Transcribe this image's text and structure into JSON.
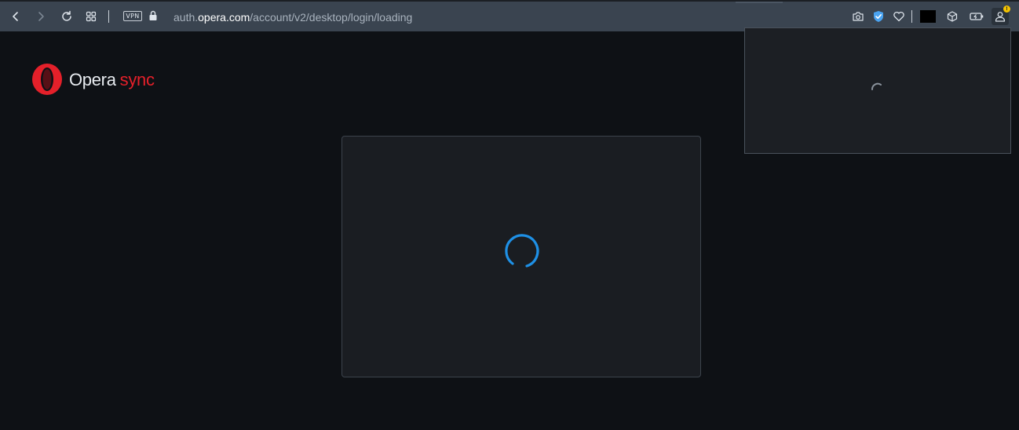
{
  "browser": {
    "address": {
      "prefix": "auth.",
      "host": "opera.com",
      "path": "/account/v2/desktop/login/loading"
    },
    "vpn_label": "VPN",
    "profile_badge": "!",
    "icons": {
      "back": "chevron-left-icon",
      "forward": "chevron-right-icon",
      "reload": "reload-icon",
      "speed_dial": "grid-icon",
      "lock": "lock-icon",
      "snapshot": "camera-icon",
      "adblock": "shield-check-icon",
      "favorite": "heart-icon",
      "easy_setup": "cube-icon",
      "battery": "battery-icon",
      "profile": "user-icon"
    }
  },
  "page": {
    "logo": {
      "brand": "Opera",
      "product": "sync"
    },
    "colors": {
      "brand_red": "#e4202a",
      "spinner_blue": "#1e90e6",
      "page_bg": "#0e1115",
      "card_bg": "#1a1d22"
    },
    "status": "loading"
  }
}
